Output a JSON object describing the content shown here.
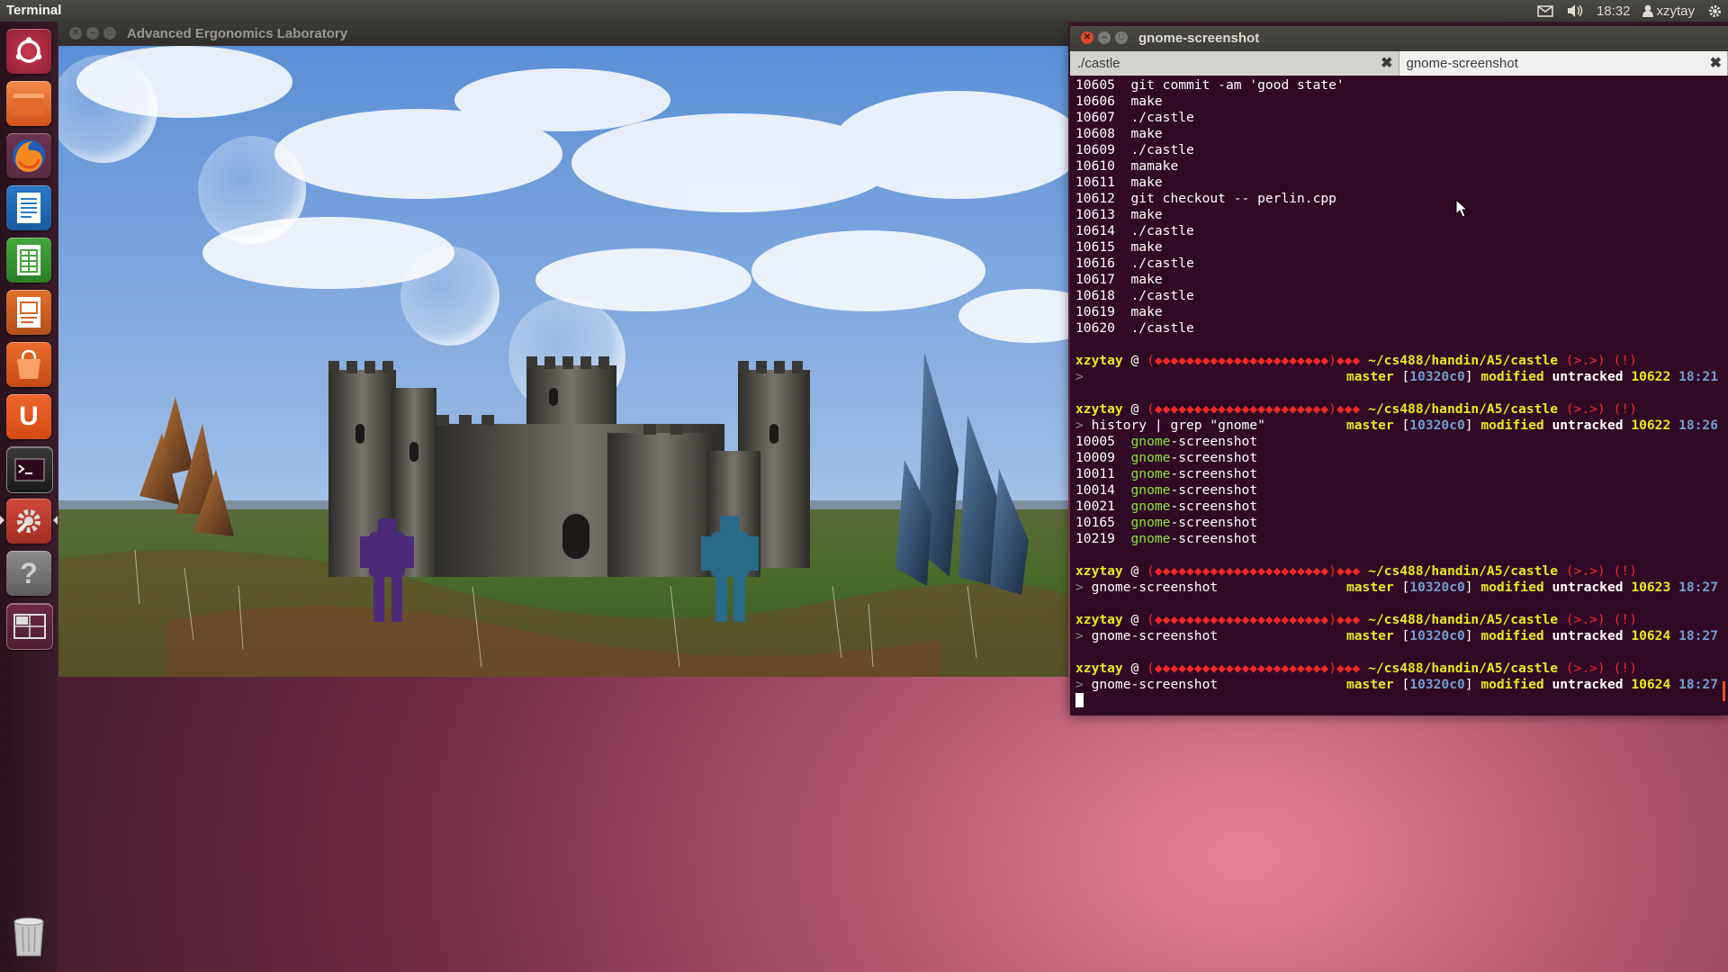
{
  "top_panel": {
    "app_title": "Terminal",
    "time": "18:32",
    "user": "xzytay"
  },
  "launcher": {
    "items": [
      "ubuntu-dash",
      "files",
      "firefox",
      "libreoffice-writer",
      "libreoffice-calc",
      "libreoffice-impress",
      "software-center",
      "ubuntu-one",
      "terminal",
      "system-settings",
      "help",
      "workspaces",
      "trash"
    ]
  },
  "game_window": {
    "title": "Advanced Ergonomics Laboratory"
  },
  "terminal_window": {
    "title": "gnome-screenshot",
    "tabs": [
      {
        "label": "./castle",
        "active": false
      },
      {
        "label": "gnome-screenshot",
        "active": true
      }
    ],
    "history": [
      {
        "num": "10605",
        "cmd": "git commit -am 'good state'"
      },
      {
        "num": "10606",
        "cmd": "make"
      },
      {
        "num": "10607",
        "cmd": "./castle"
      },
      {
        "num": "10608",
        "cmd": "make"
      },
      {
        "num": "10609",
        "cmd": "./castle"
      },
      {
        "num": "10610",
        "cmd": "mamake"
      },
      {
        "num": "10611",
        "cmd": "make"
      },
      {
        "num": "10612",
        "cmd": "git checkout -- perlin.cpp"
      },
      {
        "num": "10613",
        "cmd": "make"
      },
      {
        "num": "10614",
        "cmd": "./castle"
      },
      {
        "num": "10615",
        "cmd": "make"
      },
      {
        "num": "10616",
        "cmd": "./castle"
      },
      {
        "num": "10617",
        "cmd": "make"
      },
      {
        "num": "10618",
        "cmd": "./castle"
      },
      {
        "num": "10619",
        "cmd": "make"
      },
      {
        "num": "10620",
        "cmd": "./castle"
      }
    ],
    "prompt": {
      "user": "xzytay",
      "at": " @ ",
      "host": "(◆◆◆◆◆◆◆◆◆◆◆◆◆◆◆◆◆◆◆◆◆◆)◆◆◆",
      "path": "~/cs488/handin/A5/castle",
      "face": "(>.>) (!)",
      "branch": "master",
      "commit": "10320c0",
      "modified": "modified",
      "untracked": "untracked"
    },
    "blocks": [
      {
        "cmd": "",
        "count": "10622",
        "time": "18:21"
      },
      {
        "cmd": "history | grep \"gnome\"",
        "count": "10622",
        "time": "18:26"
      },
      {
        "cmd": "gnome-screenshot",
        "count": "10623",
        "time": "18:27"
      },
      {
        "cmd": "gnome-screenshot",
        "count": "10624",
        "time": "18:27"
      },
      {
        "cmd": "gnome-screenshot",
        "count": "10624",
        "time": "18:27"
      }
    ],
    "grep_results": [
      {
        "num": "10005",
        "match": "gnome",
        "rest": "-screenshot"
      },
      {
        "num": "10009",
        "match": "gnome",
        "rest": "-screenshot"
      },
      {
        "num": "10011",
        "match": "gnome",
        "rest": "-screenshot"
      },
      {
        "num": "10014",
        "match": "gnome",
        "rest": "-screenshot"
      },
      {
        "num": "10021",
        "match": "gnome",
        "rest": "-screenshot"
      },
      {
        "num": "10165",
        "match": "gnome",
        "rest": "-screenshot"
      },
      {
        "num": "10219",
        "match": "gnome",
        "rest": "-screenshot"
      }
    ]
  },
  "colors": {
    "terminal_bg": "#300a24",
    "ubuntu_orange": "#e95420",
    "prompt_yellow": "#e9e920",
    "prompt_red": "#ef2929",
    "grep_green": "#8ae234",
    "time_blue": "#729fcf"
  }
}
